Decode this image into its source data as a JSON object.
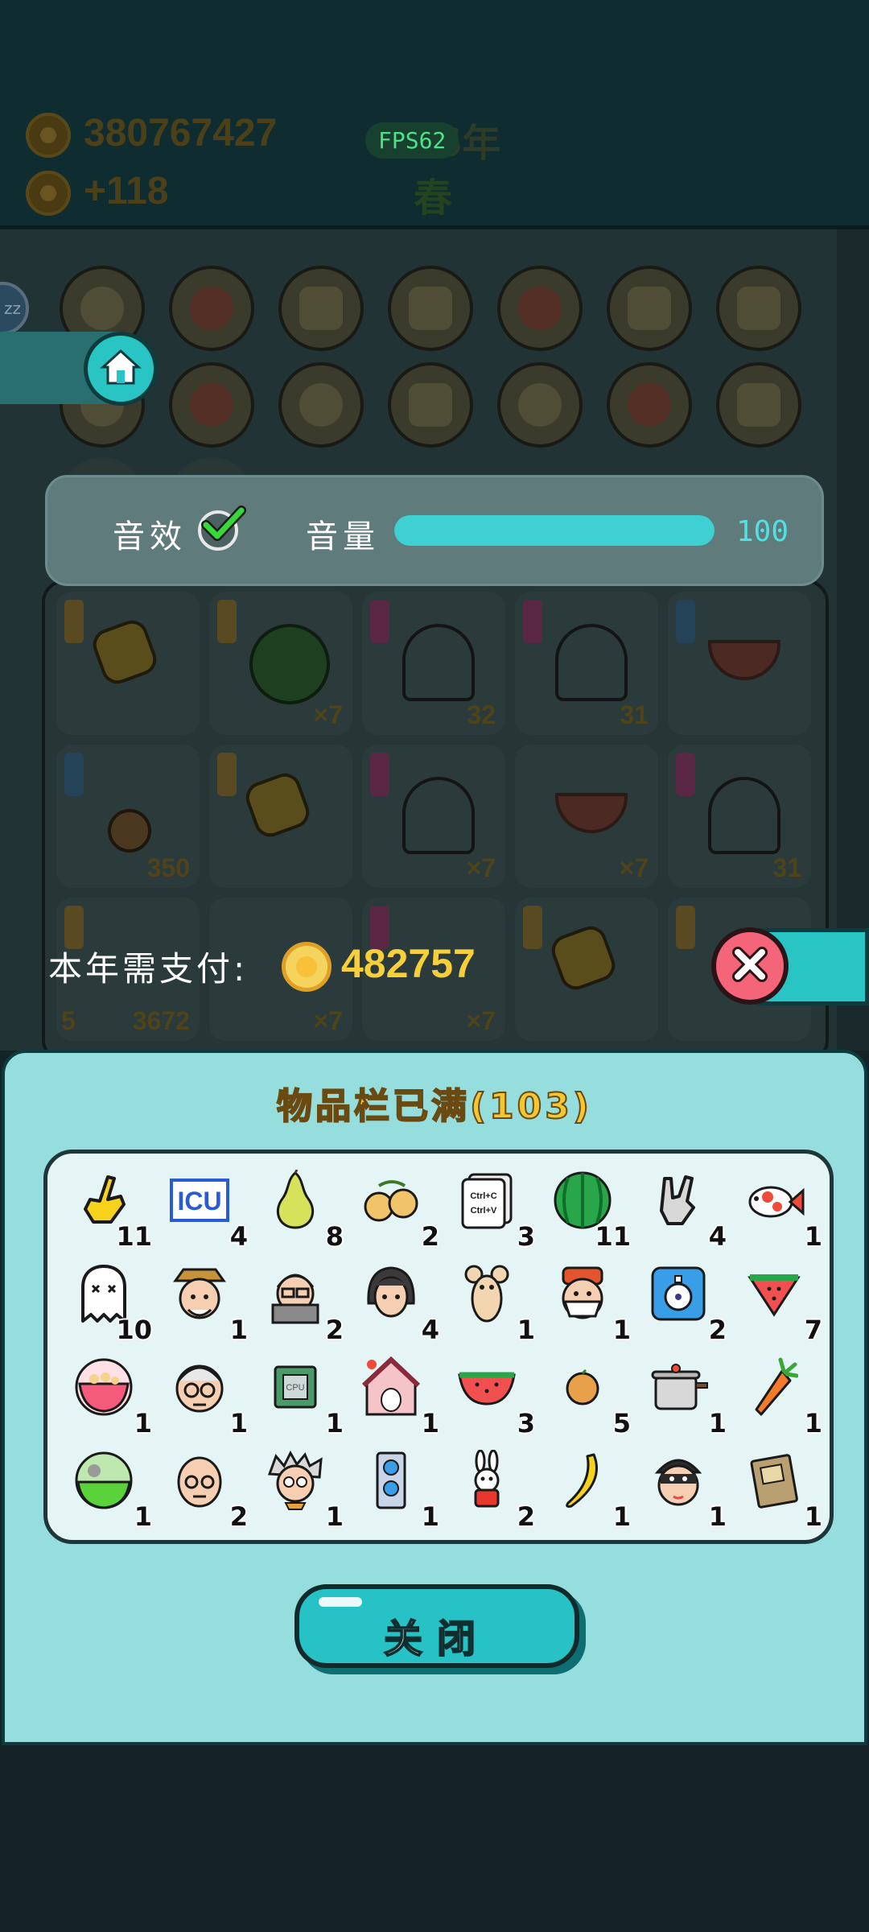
{
  "hud": {
    "money": "380767427",
    "income": "+118",
    "year": "236年",
    "season": "春",
    "fps": "FPS62"
  },
  "settings": {
    "sfx_label": "音效",
    "sfx_enabled": true,
    "volume_label": "音量",
    "volume_value": "100",
    "volume_fraction": 1.0
  },
  "background_grid": {
    "counts": [
      "×7",
      "32",
      "31",
      "350",
      "×7",
      "×7",
      "31",
      "3672",
      "×7",
      "×7"
    ],
    "partial_left": "5"
  },
  "payment": {
    "label": "本年需支付:",
    "amount": "482757"
  },
  "inventory": {
    "title": "物品栏已满(103)",
    "close_label": "关闭",
    "items": [
      {
        "icon": "pointing-hand-icon",
        "count": "11"
      },
      {
        "icon": "icu-sign-icon",
        "count": "4",
        "text": "ICU"
      },
      {
        "icon": "pear-icon",
        "count": "8"
      },
      {
        "icon": "longan-icon",
        "count": "2"
      },
      {
        "icon": "ctrl-c-ctrl-v-icon",
        "count": "3",
        "text": "Ctrl+C Ctrl+V"
      },
      {
        "icon": "watermelon-icon",
        "count": "11"
      },
      {
        "icon": "rock-hand-icon",
        "count": "4"
      },
      {
        "icon": "koi-fish-icon",
        "count": "1"
      },
      {
        "icon": "ghost-icon",
        "count": "10"
      },
      {
        "icon": "old-man-hat-icon",
        "count": "1"
      },
      {
        "icon": "programmer-glasses-icon",
        "count": "2"
      },
      {
        "icon": "long-hair-man-icon",
        "count": "4"
      },
      {
        "icon": "mouse-icon",
        "count": "1"
      },
      {
        "icon": "masked-worker-icon",
        "count": "1"
      },
      {
        "icon": "stopwatch-icon",
        "count": "2"
      },
      {
        "icon": "watermelon-slice-icon",
        "count": "7"
      },
      {
        "icon": "food-bowl-icon",
        "count": "1"
      },
      {
        "icon": "grandpa-glasses-icon",
        "count": "1"
      },
      {
        "icon": "cpu-chip-icon",
        "count": "1",
        "text": "CPU"
      },
      {
        "icon": "bunny-house-icon",
        "count": "1"
      },
      {
        "icon": "watermelon-half-icon",
        "count": "3"
      },
      {
        "icon": "orange-icon",
        "count": "5"
      },
      {
        "icon": "cooking-pot-icon",
        "count": "1"
      },
      {
        "icon": "carrot-icon",
        "count": "1"
      },
      {
        "icon": "green-ball-icon",
        "count": "1"
      },
      {
        "icon": "bald-man-icon",
        "count": "2"
      },
      {
        "icon": "crazy-scientist-icon",
        "count": "1"
      },
      {
        "icon": "graphics-card-icon",
        "count": "1"
      },
      {
        "icon": "rabbit-icon",
        "count": "2"
      },
      {
        "icon": "banana-icon",
        "count": "1"
      },
      {
        "icon": "thief-icon",
        "count": "1"
      },
      {
        "icon": "book-icon",
        "count": "1"
      }
    ]
  },
  "colors": {
    "popup_bg": "#96dede",
    "accent": "#26c2c5",
    "gold": "#f7cf3a",
    "title_gold": "#f4c632"
  }
}
